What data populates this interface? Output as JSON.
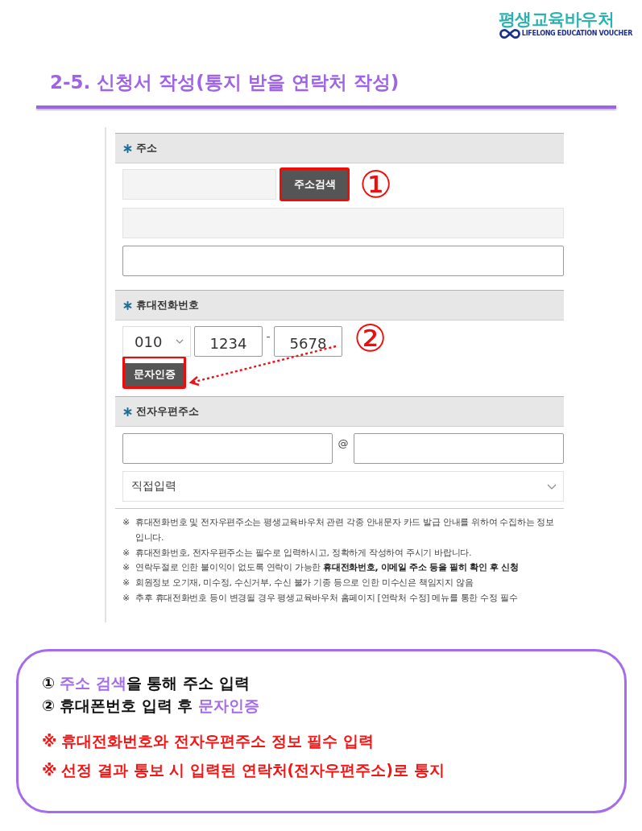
{
  "logo": {
    "name": "평생교육바우처",
    "tagline": "LIFELONG EDUCATION VOUCHER"
  },
  "title": "2-5. 신청서 작성(통지 받을 연락처 작성)",
  "form": {
    "sections": [
      {
        "kind": "address",
        "label": "주소",
        "required": true,
        "postcode_field": {
          "readonly": true
        },
        "search_button": {
          "label": "주소검색",
          "highlighted": true
        },
        "callout": "①",
        "address_field": {
          "readonly": true
        },
        "detail_field": {
          "readonly": false
        }
      },
      {
        "kind": "phone",
        "label": "휴대전화번호",
        "required": true,
        "prefix_select": {
          "value": "010"
        },
        "middle_field": {
          "value": "1234"
        },
        "separator": "-",
        "last_field": {
          "value": "5678"
        },
        "callout": "②",
        "verify_button": {
          "label": "문자인증",
          "highlighted": true
        }
      },
      {
        "kind": "email",
        "label": "전자우편주소",
        "required": true,
        "at_sign": "@",
        "domain_select": {
          "value": "직접입력"
        }
      }
    ],
    "notes": [
      {
        "mark": "※",
        "text": "휴대전화번호 및 전자우편주소는 평생교육바우처 관련 각종 안내문자 카드 발급 안내를 위하여 수집하는 정보입니다."
      },
      {
        "mark": "※",
        "text": "휴대전화번호, 전자우편주소는 필수로 입력하시고, 정확하게 작성하여 주시기 바랍니다."
      },
      {
        "mark": "※",
        "text": "연락두절로 인한 불이익이 없도록 연락이 가능한 **휴대전화번호, 이메일 주소 등을 필히 확인 후 신청**"
      },
      {
        "mark": "※",
        "text": "회원정보 오기재, 미수정, 수신거부, 수신 불가 기종 등으로 인한 미수신은 책임지지 않음"
      },
      {
        "mark": "※",
        "text": "추후 휴대전화번호 등이 변경될 경우 평생교육바우처 홈페이지 [연락처 수정] 메뉴를 통한 수정 필수"
      }
    ]
  },
  "instructions": {
    "steps": [
      {
        "number": "①",
        "parts": [
          {
            "text": "주소 검색",
            "highlight": true
          },
          {
            "text": "을 통해 주소 입력",
            "highlight": false
          }
        ]
      },
      {
        "number": "②",
        "parts": [
          {
            "text": "휴대폰번호 입력 후 ",
            "highlight": false
          },
          {
            "text": "문자인증",
            "highlight": true
          }
        ]
      }
    ],
    "warnings": [
      {
        "mark": "※",
        "text": "휴대전화번호와 전자우편주소 정보 필수 입력"
      },
      {
        "mark": "※",
        "text": "선정 결과 통보 시 입력된 연락처(전자우편주소)로 통지"
      }
    ]
  }
}
